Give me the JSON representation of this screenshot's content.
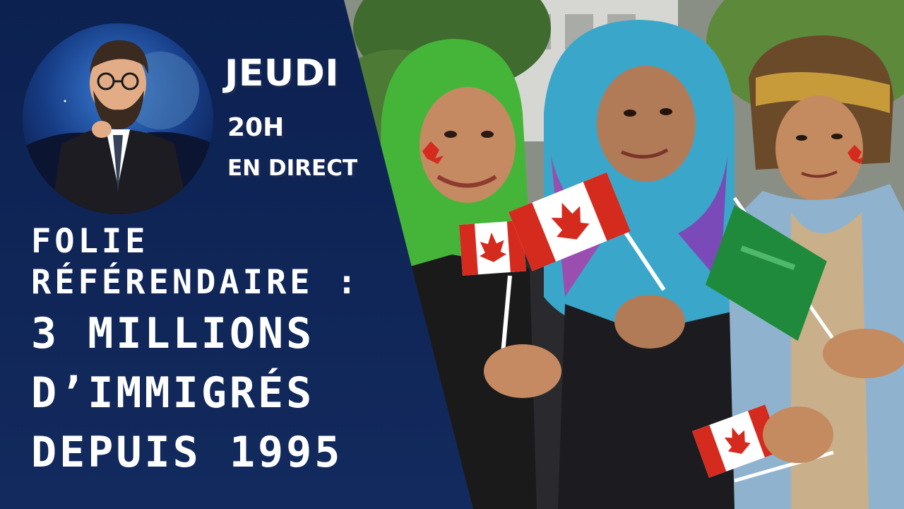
{
  "schedule": {
    "day": "JEUDI",
    "time": "20H",
    "live": "EN DIRECT"
  },
  "headline": {
    "line1": "FOLIE",
    "line2": "RÉFÉRENDAIRE :",
    "line3": "3 MILLIONS",
    "line4": "D’IMMIGRÉS",
    "line5": "DEPUIS 1995"
  },
  "colors": {
    "panel": "#0f2553",
    "canada_red": "#d52b1e",
    "saudi_green": "#1f8a3c",
    "text": "#ffffff"
  },
  "icons": {
    "avatar": "bearded-man-pointing-illustration",
    "photo": "three-women-holding-canadian-flags",
    "flag_canada": "maple-leaf-flag",
    "flag_green": "green-flag"
  }
}
